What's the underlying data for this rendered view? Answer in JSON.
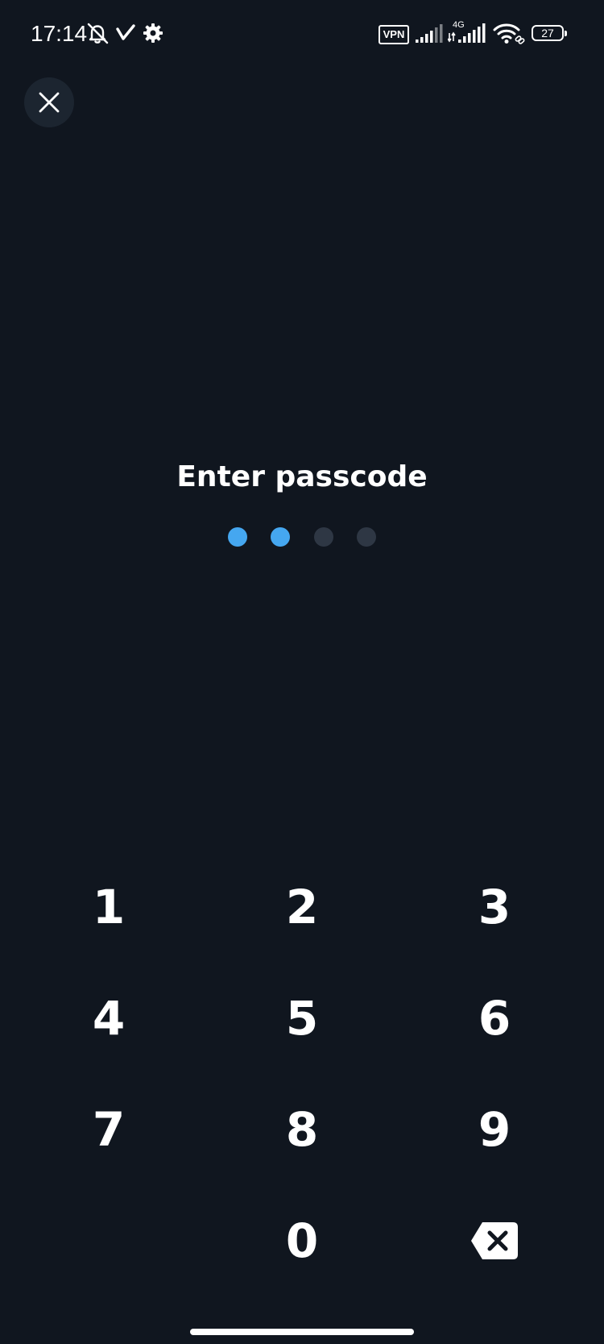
{
  "status_bar": {
    "time": "17:14",
    "icons": [
      "bell-off-icon",
      "check-icon",
      "gear-icon",
      "vpn-icon",
      "signal-icon",
      "signal-4g-icon",
      "wifi-icon",
      "battery-icon"
    ],
    "vpn_label": "VPN",
    "network_type": "4G",
    "battery_level": "27"
  },
  "header": {
    "close_icon": "close-icon"
  },
  "passcode": {
    "title": "Enter passcode",
    "entered": 2,
    "length": 4,
    "filled_color": "#45A7F0",
    "empty_color": "#2E3744"
  },
  "keypad": {
    "keys": [
      "1",
      "2",
      "3",
      "4",
      "5",
      "6",
      "7",
      "8",
      "9",
      "0"
    ],
    "backspace_icon": "backspace-icon"
  },
  "colors": {
    "background": "#10161F",
    "close_button_bg": "#1C2530",
    "text": "#ffffff"
  }
}
